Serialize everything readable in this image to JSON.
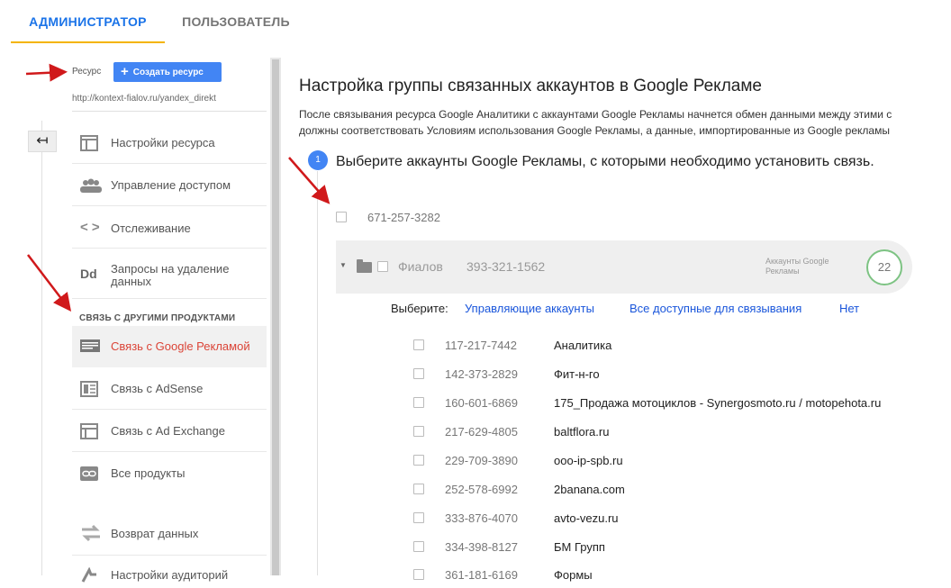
{
  "tabs": {
    "admin": "АДМИНИСТРАТОР",
    "user": "ПОЛЬЗОВАТЕЛЬ"
  },
  "sidebar": {
    "resource_label": "Ресурс",
    "create_button": "Создать ресурс",
    "resource_url": "http://kontext-fialov.ru/yandex_direkt",
    "back_icon": "arrow-left-icon",
    "section_heading": "СВЯЗЬ С ДРУГИМИ ПРОДУКТАМИ",
    "items": [
      {
        "label": "Настройки ресурса",
        "icon": "window-icon"
      },
      {
        "label": "Управление доступом",
        "icon": "people-icon"
      },
      {
        "label": "Отслеживание",
        "icon": "code-icon"
      },
      {
        "label": "Запросы на удаление данных",
        "icon": "dd-icon"
      },
      {
        "label": "Связь с Google Рекламой",
        "icon": "ads-icon"
      },
      {
        "label": "Связь с AdSense",
        "icon": "adsense-icon"
      },
      {
        "label": "Связь с Ad Exchange",
        "icon": "adexchange-icon"
      },
      {
        "label": "Все продукты",
        "icon": "link-icon"
      },
      {
        "label": "Возврат данных",
        "icon": "swap-icon"
      },
      {
        "label": "Настройки аудиторий",
        "icon": "audience-icon"
      }
    ]
  },
  "main": {
    "title": "Настройка группы связанных аккаунтов в Google Рекламе",
    "desc_line1": "После связывания ресурса Google Аналитики с аккаунтами Google Рекламы начнется обмен данными между этими с",
    "desc_line2": "должны соответствовать Условиям использования Google Рекламы, а данные, импортированные из Google рекламы",
    "step_number": "1",
    "step_title": "Выберите аккаунты Google Рекламы, с которыми необходимо установить связь.",
    "top_account": "671-257-3282",
    "group": {
      "name": "Фиалов",
      "number": "393-321-1562",
      "accounts_label": "Аккаунты Google Рекламы",
      "count": "22"
    },
    "select": {
      "label": "Выберите:",
      "managers": "Управляющие аккаунты",
      "all": "Все доступные для связывания",
      "none": "Нет"
    },
    "accounts": [
      {
        "number": "117-217-7442",
        "name": "Аналитика"
      },
      {
        "number": "142-373-2829",
        "name": "Фит-н-го"
      },
      {
        "number": "160-601-6869",
        "name": "175_Продажа мотоциклов - Synergosmoto.ru / motopehota.ru"
      },
      {
        "number": "217-629-4805",
        "name": "baltflora.ru"
      },
      {
        "number": "229-709-3890",
        "name": "ooo-ip-spb.ru"
      },
      {
        "number": "252-578-6992",
        "name": "2banana.com"
      },
      {
        "number": "333-876-4070",
        "name": "avto-vezu.ru"
      },
      {
        "number": "334-398-8127",
        "name": "БМ Групп"
      },
      {
        "number": "361-181-6169",
        "name": "Формы"
      }
    ]
  },
  "colors": {
    "accent": "#1a73e8",
    "tab_underline": "#f4b400",
    "active_nav": "#db4437",
    "arrow": "#d0191b",
    "count_ring": "#7dc383"
  }
}
